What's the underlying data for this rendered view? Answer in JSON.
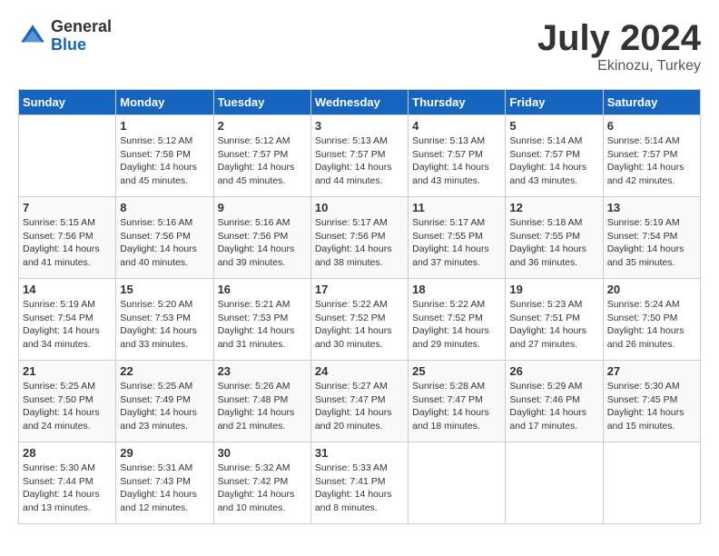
{
  "header": {
    "logo_general": "General",
    "logo_blue": "Blue",
    "month_title": "July 2024",
    "subtitle": "Ekinozu, Turkey"
  },
  "days_of_week": [
    "Sunday",
    "Monday",
    "Tuesday",
    "Wednesday",
    "Thursday",
    "Friday",
    "Saturday"
  ],
  "weeks": [
    [
      {
        "day": "",
        "info": ""
      },
      {
        "day": "1",
        "info": "Sunrise: 5:12 AM\nSunset: 7:58 PM\nDaylight: 14 hours\nand 45 minutes."
      },
      {
        "day": "2",
        "info": "Sunrise: 5:12 AM\nSunset: 7:57 PM\nDaylight: 14 hours\nand 45 minutes."
      },
      {
        "day": "3",
        "info": "Sunrise: 5:13 AM\nSunset: 7:57 PM\nDaylight: 14 hours\nand 44 minutes."
      },
      {
        "day": "4",
        "info": "Sunrise: 5:13 AM\nSunset: 7:57 PM\nDaylight: 14 hours\nand 43 minutes."
      },
      {
        "day": "5",
        "info": "Sunrise: 5:14 AM\nSunset: 7:57 PM\nDaylight: 14 hours\nand 43 minutes."
      },
      {
        "day": "6",
        "info": "Sunrise: 5:14 AM\nSunset: 7:57 PM\nDaylight: 14 hours\nand 42 minutes."
      }
    ],
    [
      {
        "day": "7",
        "info": "Sunrise: 5:15 AM\nSunset: 7:56 PM\nDaylight: 14 hours\nand 41 minutes."
      },
      {
        "day": "8",
        "info": "Sunrise: 5:16 AM\nSunset: 7:56 PM\nDaylight: 14 hours\nand 40 minutes."
      },
      {
        "day": "9",
        "info": "Sunrise: 5:16 AM\nSunset: 7:56 PM\nDaylight: 14 hours\nand 39 minutes."
      },
      {
        "day": "10",
        "info": "Sunrise: 5:17 AM\nSunset: 7:56 PM\nDaylight: 14 hours\nand 38 minutes."
      },
      {
        "day": "11",
        "info": "Sunrise: 5:17 AM\nSunset: 7:55 PM\nDaylight: 14 hours\nand 37 minutes."
      },
      {
        "day": "12",
        "info": "Sunrise: 5:18 AM\nSunset: 7:55 PM\nDaylight: 14 hours\nand 36 minutes."
      },
      {
        "day": "13",
        "info": "Sunrise: 5:19 AM\nSunset: 7:54 PM\nDaylight: 14 hours\nand 35 minutes."
      }
    ],
    [
      {
        "day": "14",
        "info": "Sunrise: 5:19 AM\nSunset: 7:54 PM\nDaylight: 14 hours\nand 34 minutes."
      },
      {
        "day": "15",
        "info": "Sunrise: 5:20 AM\nSunset: 7:53 PM\nDaylight: 14 hours\nand 33 minutes."
      },
      {
        "day": "16",
        "info": "Sunrise: 5:21 AM\nSunset: 7:53 PM\nDaylight: 14 hours\nand 31 minutes."
      },
      {
        "day": "17",
        "info": "Sunrise: 5:22 AM\nSunset: 7:52 PM\nDaylight: 14 hours\nand 30 minutes."
      },
      {
        "day": "18",
        "info": "Sunrise: 5:22 AM\nSunset: 7:52 PM\nDaylight: 14 hours\nand 29 minutes."
      },
      {
        "day": "19",
        "info": "Sunrise: 5:23 AM\nSunset: 7:51 PM\nDaylight: 14 hours\nand 27 minutes."
      },
      {
        "day": "20",
        "info": "Sunrise: 5:24 AM\nSunset: 7:50 PM\nDaylight: 14 hours\nand 26 minutes."
      }
    ],
    [
      {
        "day": "21",
        "info": "Sunrise: 5:25 AM\nSunset: 7:50 PM\nDaylight: 14 hours\nand 24 minutes."
      },
      {
        "day": "22",
        "info": "Sunrise: 5:25 AM\nSunset: 7:49 PM\nDaylight: 14 hours\nand 23 minutes."
      },
      {
        "day": "23",
        "info": "Sunrise: 5:26 AM\nSunset: 7:48 PM\nDaylight: 14 hours\nand 21 minutes."
      },
      {
        "day": "24",
        "info": "Sunrise: 5:27 AM\nSunset: 7:47 PM\nDaylight: 14 hours\nand 20 minutes."
      },
      {
        "day": "25",
        "info": "Sunrise: 5:28 AM\nSunset: 7:47 PM\nDaylight: 14 hours\nand 18 minutes."
      },
      {
        "day": "26",
        "info": "Sunrise: 5:29 AM\nSunset: 7:46 PM\nDaylight: 14 hours\nand 17 minutes."
      },
      {
        "day": "27",
        "info": "Sunrise: 5:30 AM\nSunset: 7:45 PM\nDaylight: 14 hours\nand 15 minutes."
      }
    ],
    [
      {
        "day": "28",
        "info": "Sunrise: 5:30 AM\nSunset: 7:44 PM\nDaylight: 14 hours\nand 13 minutes."
      },
      {
        "day": "29",
        "info": "Sunrise: 5:31 AM\nSunset: 7:43 PM\nDaylight: 14 hours\nand 12 minutes."
      },
      {
        "day": "30",
        "info": "Sunrise: 5:32 AM\nSunset: 7:42 PM\nDaylight: 14 hours\nand 10 minutes."
      },
      {
        "day": "31",
        "info": "Sunrise: 5:33 AM\nSunset: 7:41 PM\nDaylight: 14 hours\nand 8 minutes."
      },
      {
        "day": "",
        "info": ""
      },
      {
        "day": "",
        "info": ""
      },
      {
        "day": "",
        "info": ""
      }
    ]
  ]
}
